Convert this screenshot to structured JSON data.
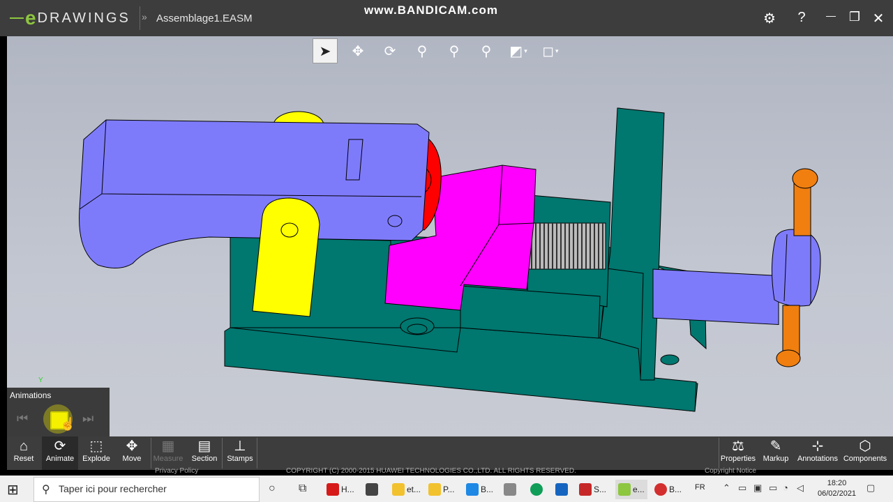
{
  "watermark": "www.BANDICAM.com",
  "app": {
    "brand_letter": "e",
    "brand_rest": "DRAWINGS",
    "document_title": "Assemblage1.EASM"
  },
  "title_icons": [
    "gear-icon",
    "help-icon",
    "minimize-icon",
    "restore-icon",
    "close-icon"
  ],
  "title_glyphs": {
    "settings": "⚙",
    "help": "?",
    "minimize": "—",
    "restore": "❐",
    "close": "✕",
    "chevron": "»"
  },
  "view_tools": [
    {
      "name": "select-tool-icon",
      "glyph": "➤",
      "active": true
    },
    {
      "name": "pan-tool-icon",
      "glyph": "✥"
    },
    {
      "name": "rotate-tool-icon",
      "glyph": "⟳"
    },
    {
      "name": "zoom-tool-icon",
      "glyph": "⚲"
    },
    {
      "name": "zoom-area-icon",
      "glyph": "⚲"
    },
    {
      "name": "zoom-fit-icon",
      "glyph": "⚲"
    },
    {
      "name": "display-style-icon",
      "glyph": "◩",
      "dropdown": true
    },
    {
      "name": "view-orientation-icon",
      "glyph": "◻",
      "dropdown": true
    }
  ],
  "triad_axis": "Y",
  "animations": {
    "title": "Animations",
    "prev": "⏮",
    "next": "⏭"
  },
  "bottom_toolbar": {
    "left": [
      {
        "label": "Reset",
        "glyph": "⌂"
      },
      {
        "label": "Animate",
        "glyph": "⟳",
        "active": true
      },
      {
        "label": "Explode",
        "glyph": "⬚"
      },
      {
        "label": "Move",
        "glyph": "✥"
      },
      {
        "label": "Measure",
        "glyph": "▦",
        "disabled": true
      },
      {
        "label": "Section",
        "glyph": "▤"
      },
      {
        "label": "Stamps",
        "glyph": "⊥"
      }
    ],
    "right": [
      {
        "label": "Properties",
        "glyph": "⚖"
      },
      {
        "label": "Markup",
        "glyph": "✎"
      },
      {
        "label": "Annotations",
        "glyph": "⊹"
      },
      {
        "label": "Components",
        "glyph": "⬡"
      }
    ]
  },
  "footer": {
    "privacy": "Privacy Policy",
    "copyright": "COPYRIGHT (C) 2000-2015 HUAWEI TECHNOLOGIES CO.,LTD. ALL RIGHTS RESERVED.",
    "notice": "Copyright Notice"
  },
  "taskbar": {
    "search_placeholder": "Taper ici pour rechercher",
    "apps": [
      {
        "label": "H...",
        "color": "#d61a1a"
      },
      {
        "label": "",
        "color": "#444444"
      },
      {
        "label": "et...",
        "color": "#f2c12e"
      },
      {
        "label": "P...",
        "color": "#f2c12e"
      },
      {
        "label": "B...",
        "color": "#1e88e5"
      },
      {
        "label": "",
        "color": "#888888"
      },
      {
        "label": "",
        "color": "#0f9d58"
      },
      {
        "label": "",
        "color": "#1565c0"
      },
      {
        "label": "S...",
        "color": "#c62828"
      },
      {
        "label": "e...",
        "color": "#8dc63f"
      },
      {
        "label": "B...",
        "color": "#d32f2f"
      }
    ],
    "language": "FR",
    "time": "18:20",
    "date": "06/02/2021"
  },
  "colors": {
    "teal": "#00776f",
    "blue": "#7e7bfb",
    "magenta": "#ff00ff",
    "red": "#ff0000",
    "yellow": "#ffff00",
    "orange": "#f07f10"
  }
}
